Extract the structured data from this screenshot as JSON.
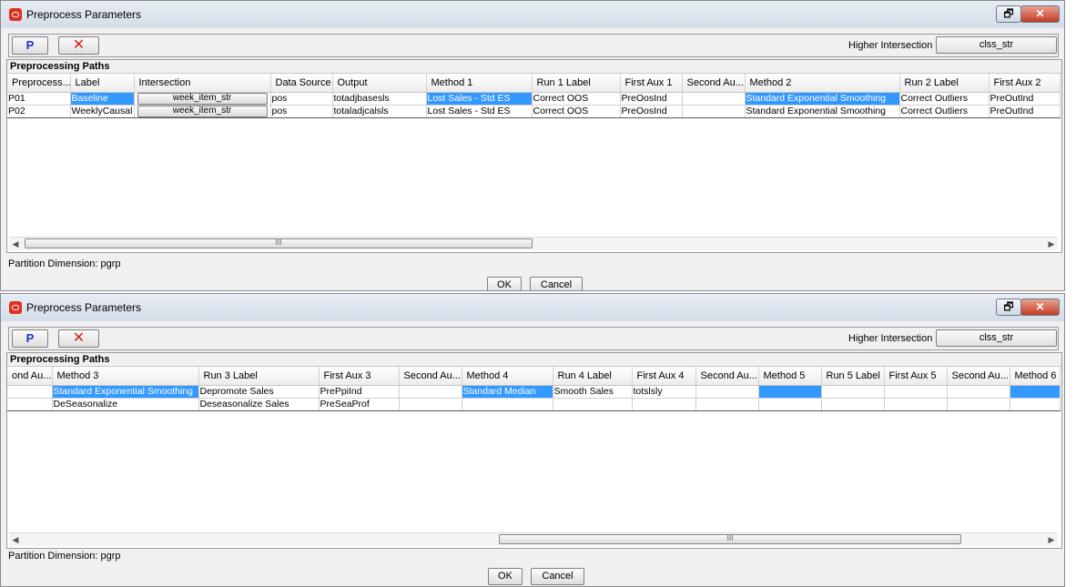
{
  "windows": [
    {
      "title": "Preprocess Parameters",
      "toolbar": {
        "p_label": "P",
        "delete_label": "✕",
        "higher_label": "Higher Intersection",
        "higher_value": "clss_str"
      },
      "panel_title": "Preprocessing Paths",
      "columns": [
        "Preprocess...",
        "Label",
        "Intersection",
        "Data Source",
        "Output",
        "Method 1",
        "Run 1 Label",
        "First Aux 1",
        "Second Au...",
        "Method 2",
        "Run 2 Label",
        "First Aux 2"
      ],
      "rows": [
        [
          "P01",
          "Baseline",
          "week_item_str",
          "pos",
          "totadjbasesls",
          "Lost Sales - Std ES",
          "Correct OOS",
          "PreOosInd",
          "",
          "Standard Exponential Smoothing",
          "Correct Outliers",
          "PreOutInd"
        ],
        [
          "P02",
          "WeeklyCausal",
          "week_item_str",
          "pos",
          "totaladjcalsls",
          "Lost Sales - Std ES",
          "Correct OOS",
          "PreOosInd",
          "",
          "Standard Exponential Smoothing",
          "Correct Outliers",
          "PreOutInd"
        ]
      ],
      "scroll_grip": "III",
      "partition": "Partition Dimension:  pgrp",
      "ok_label": "OK",
      "cancel_label": "Cancel"
    },
    {
      "title": "Preprocess Parameters",
      "toolbar": {
        "p_label": "P",
        "delete_label": "✕",
        "higher_label": "Higher Intersection",
        "higher_value": "clss_str"
      },
      "panel_title": "Preprocessing Paths",
      "columns": [
        "ond Au...",
        "Method 3",
        "Run 3 Label",
        "First Aux 3",
        "Second Au...",
        "Method 4",
        "Run 4 Label",
        "First Aux 4",
        "Second Au...",
        "Method 5",
        "Run 5 Label",
        "First Aux 5",
        "Second Au...",
        "Method 6"
      ],
      "rows": [
        [
          "",
          "Standard Exponential Smoothing",
          "Depromote Sales",
          "PrePpiInd",
          "",
          "Standard Median",
          "Smooth Sales",
          "totslsly",
          "",
          "",
          "",
          "",
          "",
          ""
        ],
        [
          "",
          "DeSeasonalize",
          "Deseasonalize Sales",
          "PreSeaProf",
          "",
          "",
          "",
          "",
          "",
          "",
          "",
          "",
          "",
          ""
        ]
      ],
      "scroll_grip": "III",
      "partition": "Partition Dimension:  pgrp",
      "ok_label": "OK",
      "cancel_label": "Cancel"
    }
  ]
}
